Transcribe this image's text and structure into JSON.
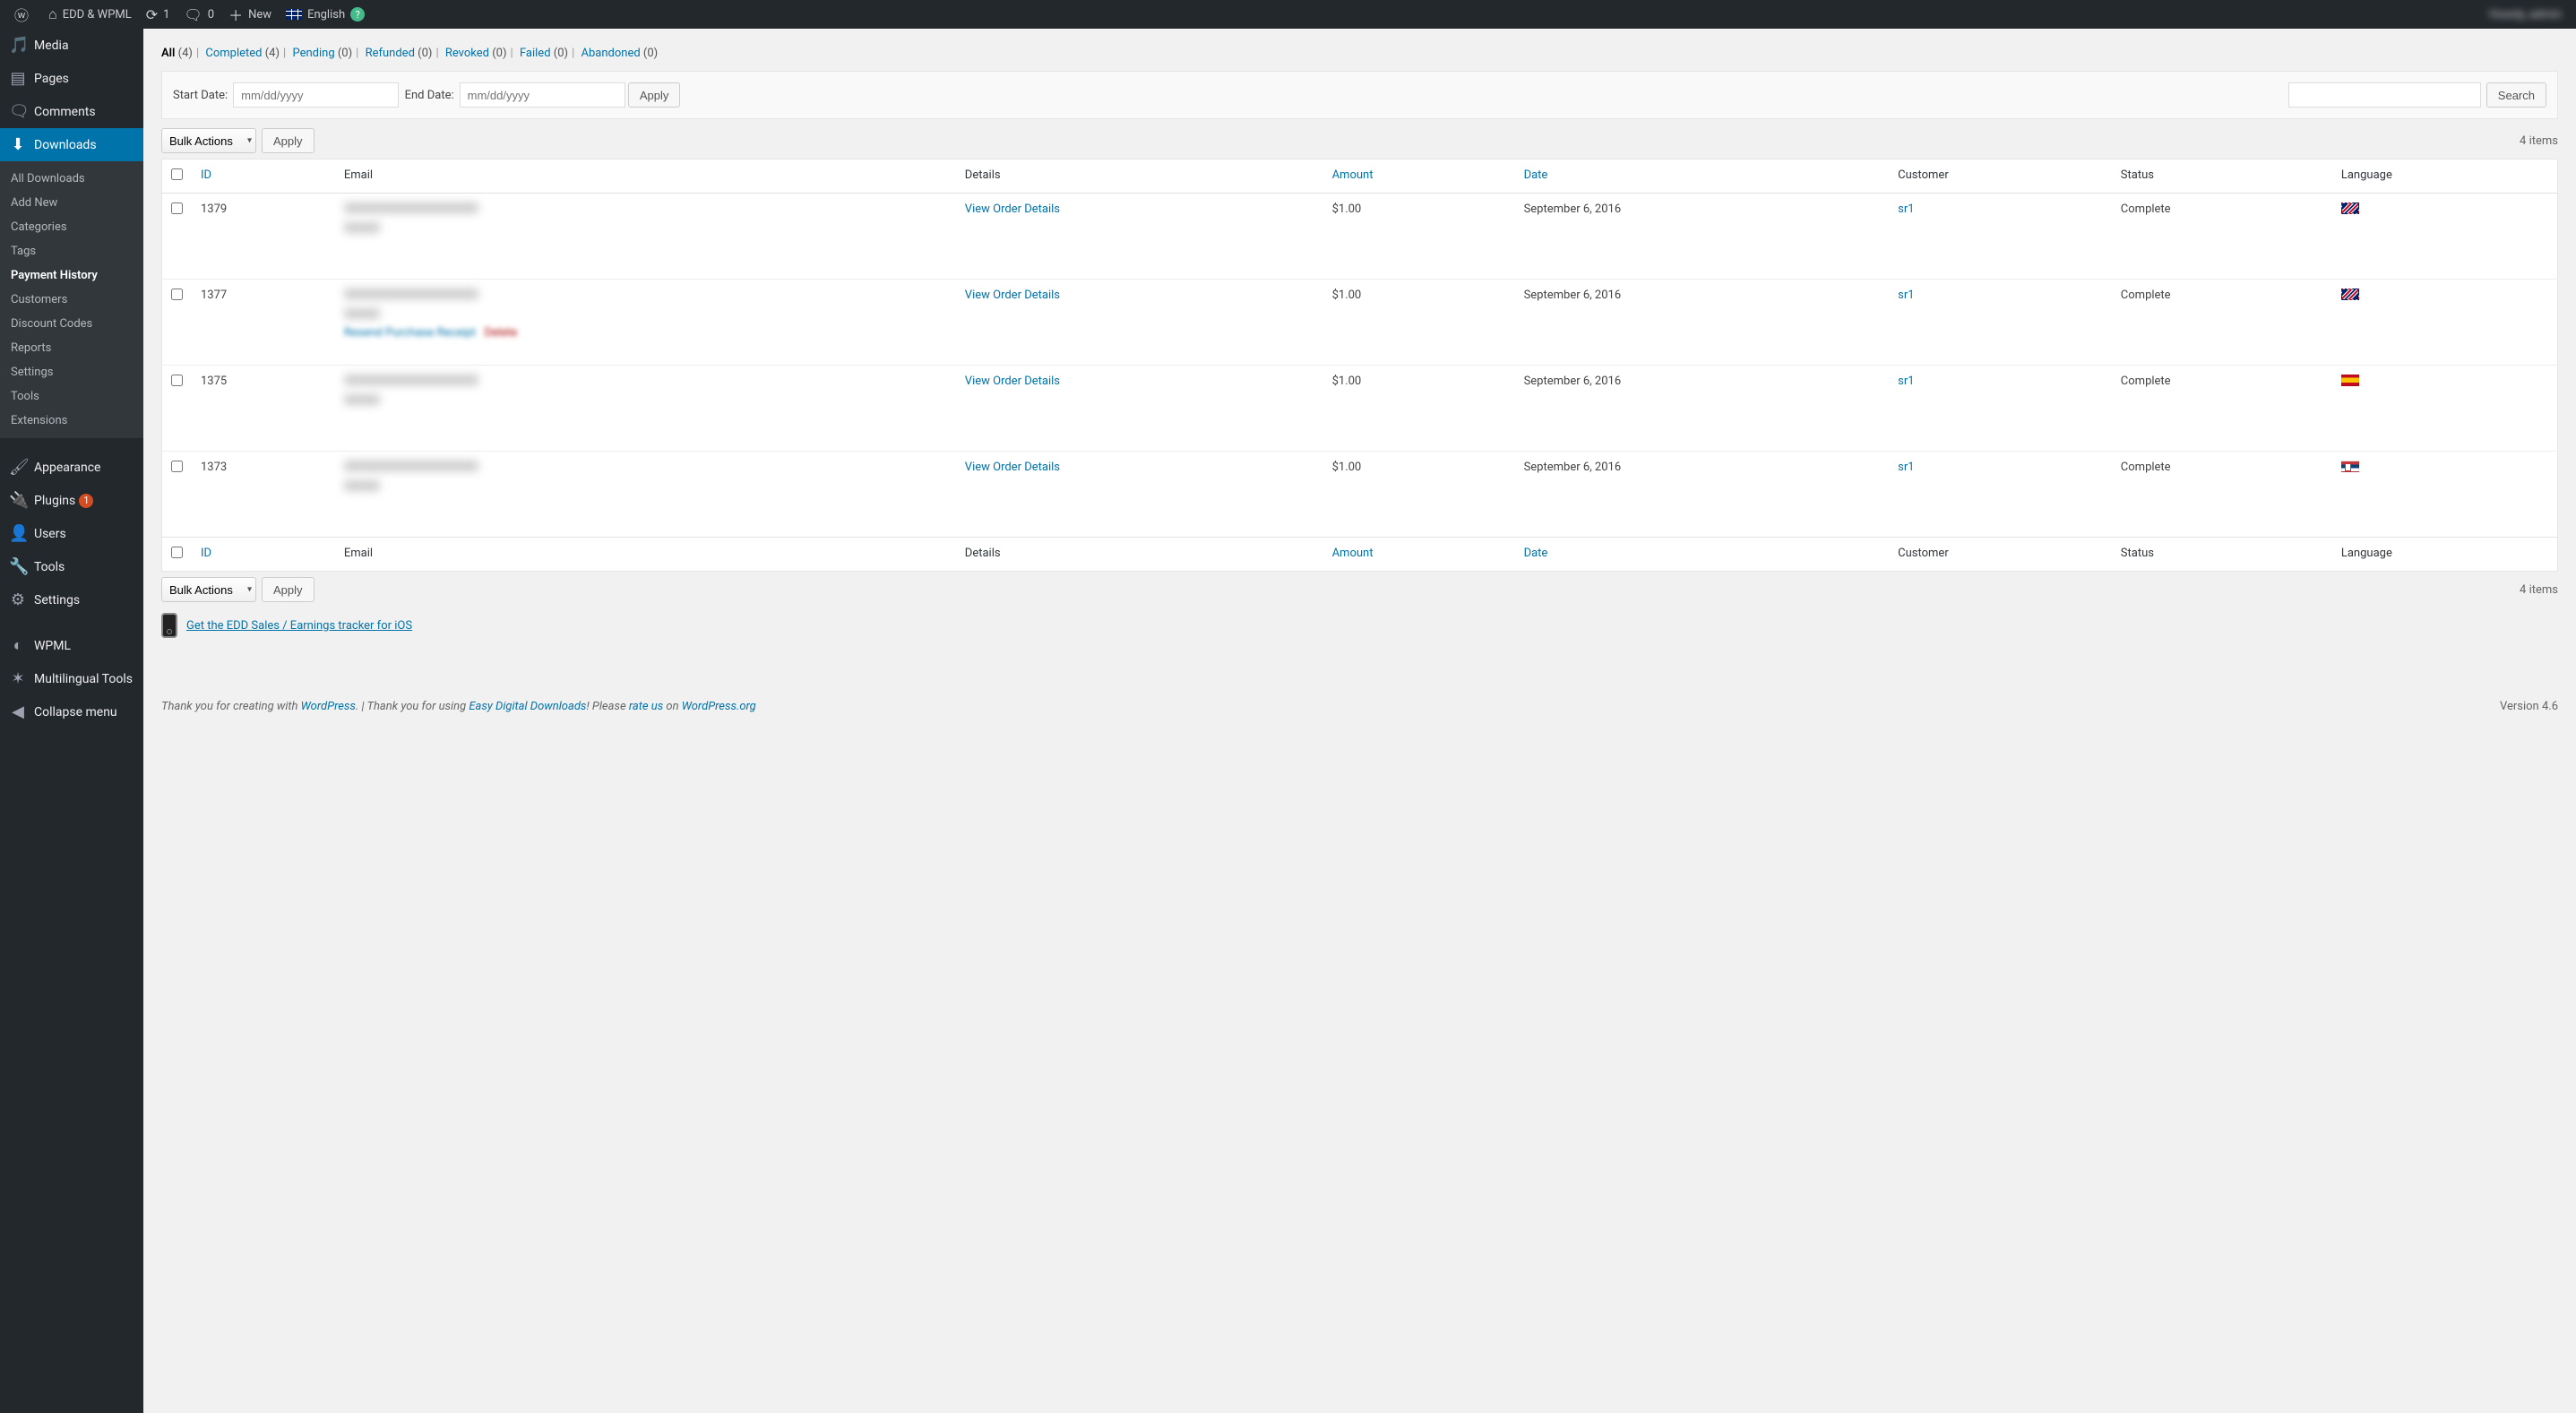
{
  "adminbar": {
    "site_title": "EDD & WPML",
    "updates": "1",
    "comments": "0",
    "new_label": "New",
    "lang_label": "English",
    "user_display": "Howdy, admin"
  },
  "sidebar": {
    "media": "Media",
    "pages": "Pages",
    "comments": "Comments",
    "downloads": "Downloads",
    "downloads_sub": {
      "all": "All Downloads",
      "add_new": "Add New",
      "categories": "Categories",
      "tags": "Tags",
      "payment_history": "Payment History",
      "customers": "Customers",
      "discount_codes": "Discount Codes",
      "reports": "Reports",
      "settings": "Settings",
      "tools": "Tools",
      "extensions": "Extensions"
    },
    "appearance": "Appearance",
    "plugins": "Plugins",
    "plugins_count": "1",
    "users": "Users",
    "tools": "Tools",
    "settings": "Settings",
    "wpml": "WPML",
    "multilingual_tools": "Multilingual Tools",
    "collapse": "Collapse menu"
  },
  "filters": {
    "all_label": "All",
    "all_count": "(4)",
    "completed_label": "Completed",
    "completed_count": "(4)",
    "pending_label": "Pending",
    "pending_count": "(0)",
    "refunded_label": "Refunded",
    "refunded_count": "(0)",
    "revoked_label": "Revoked",
    "revoked_count": "(0)",
    "failed_label": "Failed",
    "failed_count": "(0)",
    "abandoned_label": "Abandoned",
    "abandoned_count": "(0)"
  },
  "datefilter": {
    "start_label": "Start Date:",
    "start_placeholder": "mm/dd/yyyy",
    "end_label": "End Date:",
    "end_placeholder": "mm/dd/yyyy",
    "apply": "Apply",
    "search": "Search"
  },
  "bulk": {
    "label": "Bulk Actions",
    "apply": "Apply",
    "count": "4 items"
  },
  "columns": {
    "id": "ID",
    "email": "Email",
    "details": "Details",
    "amount": "Amount",
    "date": "Date",
    "customer": "Customer",
    "status": "Status",
    "language": "Language"
  },
  "rows": [
    {
      "id": "1379",
      "details": "View Order Details",
      "amount": "$1.00",
      "date": "September 6, 2016",
      "customer": "sr1",
      "status": "Complete",
      "flag": "gb"
    },
    {
      "id": "1377",
      "details": "View Order Details",
      "amount": "$1.00",
      "date": "September 6, 2016",
      "customer": "sr1",
      "status": "Complete",
      "flag": "gb",
      "actions": true
    },
    {
      "id": "1375",
      "details": "View Order Details",
      "amount": "$1.00",
      "date": "September 6, 2016",
      "customer": "sr1",
      "status": "Complete",
      "flag": "es"
    },
    {
      "id": "1373",
      "details": "View Order Details",
      "amount": "$1.00",
      "date": "September 6, 2016",
      "customer": "sr1",
      "status": "Complete",
      "flag": "rs"
    }
  ],
  "promo": {
    "link": "Get the EDD Sales / Earnings tracker for iOS"
  },
  "footer": {
    "thank_wp_pre": "Thank you for creating with ",
    "wp": "WordPress",
    "thank_wp_post": ".",
    "thank_edd_pre": " | Thank you for using ",
    "edd": "Easy Digital Downloads",
    "thank_edd_post": "! Please ",
    "rate": "rate us",
    "on": " on ",
    "wporg": "WordPress.org",
    "version": "Version 4.6"
  }
}
